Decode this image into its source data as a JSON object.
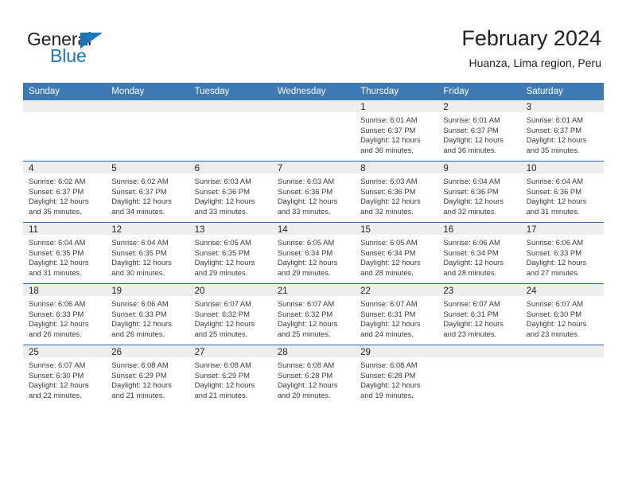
{
  "brand": {
    "name_part1": "General",
    "name_part2": "Blue",
    "accent_color": "#1b75bb",
    "text_color": "#231f20"
  },
  "header": {
    "title": "February 2024",
    "subtitle": "Huanza, Lima region, Peru"
  },
  "theme": {
    "header_blue": "#3c79b5",
    "row_divider": "#2f6da8",
    "daynum_band": "#eeeeee",
    "body_text": "#3a3a3a"
  },
  "weekdays": [
    "Sunday",
    "Monday",
    "Tuesday",
    "Wednesday",
    "Thursday",
    "Friday",
    "Saturday"
  ],
  "labels": {
    "sunrise_prefix": "Sunrise:",
    "sunset_prefix": "Sunset:",
    "daylight_prefix": "Daylight:"
  },
  "weeks": [
    [
      {
        "day": "",
        "blank": true,
        "l1": "",
        "l2": "",
        "l3": "",
        "l4": ""
      },
      {
        "day": "",
        "blank": true,
        "l1": "",
        "l2": "",
        "l3": "",
        "l4": ""
      },
      {
        "day": "",
        "blank": true,
        "l1": "",
        "l2": "",
        "l3": "",
        "l4": ""
      },
      {
        "day": "",
        "blank": true,
        "l1": "",
        "l2": "",
        "l3": "",
        "l4": ""
      },
      {
        "day": "1",
        "blank": false,
        "l1": "Sunrise: 6:01 AM",
        "l2": "Sunset: 6:37 PM",
        "l3": "Daylight: 12 hours",
        "l4": "and 36 minutes."
      },
      {
        "day": "2",
        "blank": false,
        "l1": "Sunrise: 6:01 AM",
        "l2": "Sunset: 6:37 PM",
        "l3": "Daylight: 12 hours",
        "l4": "and 36 minutes."
      },
      {
        "day": "3",
        "blank": false,
        "l1": "Sunrise: 6:01 AM",
        "l2": "Sunset: 6:37 PM",
        "l3": "Daylight: 12 hours",
        "l4": "and 35 minutes."
      }
    ],
    [
      {
        "day": "4",
        "blank": false,
        "l1": "Sunrise: 6:02 AM",
        "l2": "Sunset: 6:37 PM",
        "l3": "Daylight: 12 hours",
        "l4": "and 35 minutes."
      },
      {
        "day": "5",
        "blank": false,
        "l1": "Sunrise: 6:02 AM",
        "l2": "Sunset: 6:37 PM",
        "l3": "Daylight: 12 hours",
        "l4": "and 34 minutes."
      },
      {
        "day": "6",
        "blank": false,
        "l1": "Sunrise: 6:03 AM",
        "l2": "Sunset: 6:36 PM",
        "l3": "Daylight: 12 hours",
        "l4": "and 33 minutes."
      },
      {
        "day": "7",
        "blank": false,
        "l1": "Sunrise: 6:03 AM",
        "l2": "Sunset: 6:36 PM",
        "l3": "Daylight: 12 hours",
        "l4": "and 33 minutes."
      },
      {
        "day": "8",
        "blank": false,
        "l1": "Sunrise: 6:03 AM",
        "l2": "Sunset: 6:36 PM",
        "l3": "Daylight: 12 hours",
        "l4": "and 32 minutes."
      },
      {
        "day": "9",
        "blank": false,
        "l1": "Sunrise: 6:04 AM",
        "l2": "Sunset: 6:36 PM",
        "l3": "Daylight: 12 hours",
        "l4": "and 32 minutes."
      },
      {
        "day": "10",
        "blank": false,
        "l1": "Sunrise: 6:04 AM",
        "l2": "Sunset: 6:36 PM",
        "l3": "Daylight: 12 hours",
        "l4": "and 31 minutes."
      }
    ],
    [
      {
        "day": "11",
        "blank": false,
        "l1": "Sunrise: 6:04 AM",
        "l2": "Sunset: 6:35 PM",
        "l3": "Daylight: 12 hours",
        "l4": "and 31 minutes."
      },
      {
        "day": "12",
        "blank": false,
        "l1": "Sunrise: 6:04 AM",
        "l2": "Sunset: 6:35 PM",
        "l3": "Daylight: 12 hours",
        "l4": "and 30 minutes."
      },
      {
        "day": "13",
        "blank": false,
        "l1": "Sunrise: 6:05 AM",
        "l2": "Sunset: 6:35 PM",
        "l3": "Daylight: 12 hours",
        "l4": "and 29 minutes."
      },
      {
        "day": "14",
        "blank": false,
        "l1": "Sunrise: 6:05 AM",
        "l2": "Sunset: 6:34 PM",
        "l3": "Daylight: 12 hours",
        "l4": "and 29 minutes."
      },
      {
        "day": "15",
        "blank": false,
        "l1": "Sunrise: 6:05 AM",
        "l2": "Sunset: 6:34 PM",
        "l3": "Daylight: 12 hours",
        "l4": "and 28 minutes."
      },
      {
        "day": "16",
        "blank": false,
        "l1": "Sunrise: 6:06 AM",
        "l2": "Sunset: 6:34 PM",
        "l3": "Daylight: 12 hours",
        "l4": "and 28 minutes."
      },
      {
        "day": "17",
        "blank": false,
        "l1": "Sunrise: 6:06 AM",
        "l2": "Sunset: 6:33 PM",
        "l3": "Daylight: 12 hours",
        "l4": "and 27 minutes."
      }
    ],
    [
      {
        "day": "18",
        "blank": false,
        "l1": "Sunrise: 6:06 AM",
        "l2": "Sunset: 6:33 PM",
        "l3": "Daylight: 12 hours",
        "l4": "and 26 minutes."
      },
      {
        "day": "19",
        "blank": false,
        "l1": "Sunrise: 6:06 AM",
        "l2": "Sunset: 6:33 PM",
        "l3": "Daylight: 12 hours",
        "l4": "and 26 minutes."
      },
      {
        "day": "20",
        "blank": false,
        "l1": "Sunrise: 6:07 AM",
        "l2": "Sunset: 6:32 PM",
        "l3": "Daylight: 12 hours",
        "l4": "and 25 minutes."
      },
      {
        "day": "21",
        "blank": false,
        "l1": "Sunrise: 6:07 AM",
        "l2": "Sunset: 6:32 PM",
        "l3": "Daylight: 12 hours",
        "l4": "and 25 minutes."
      },
      {
        "day": "22",
        "blank": false,
        "l1": "Sunrise: 6:07 AM",
        "l2": "Sunset: 6:31 PM",
        "l3": "Daylight: 12 hours",
        "l4": "and 24 minutes."
      },
      {
        "day": "23",
        "blank": false,
        "l1": "Sunrise: 6:07 AM",
        "l2": "Sunset: 6:31 PM",
        "l3": "Daylight: 12 hours",
        "l4": "and 23 minutes."
      },
      {
        "day": "24",
        "blank": false,
        "l1": "Sunrise: 6:07 AM",
        "l2": "Sunset: 6:30 PM",
        "l3": "Daylight: 12 hours",
        "l4": "and 23 minutes."
      }
    ],
    [
      {
        "day": "25",
        "blank": false,
        "l1": "Sunrise: 6:07 AM",
        "l2": "Sunset: 6:30 PM",
        "l3": "Daylight: 12 hours",
        "l4": "and 22 minutes."
      },
      {
        "day": "26",
        "blank": false,
        "l1": "Sunrise: 6:08 AM",
        "l2": "Sunset: 6:29 PM",
        "l3": "Daylight: 12 hours",
        "l4": "and 21 minutes."
      },
      {
        "day": "27",
        "blank": false,
        "l1": "Sunrise: 6:08 AM",
        "l2": "Sunset: 6:29 PM",
        "l3": "Daylight: 12 hours",
        "l4": "and 21 minutes."
      },
      {
        "day": "28",
        "blank": false,
        "l1": "Sunrise: 6:08 AM",
        "l2": "Sunset: 6:28 PM",
        "l3": "Daylight: 12 hours",
        "l4": "and 20 minutes."
      },
      {
        "day": "29",
        "blank": false,
        "l1": "Sunrise: 6:08 AM",
        "l2": "Sunset: 6:28 PM",
        "l3": "Daylight: 12 hours",
        "l4": "and 19 minutes."
      },
      {
        "day": "",
        "blank": true,
        "l1": "",
        "l2": "",
        "l3": "",
        "l4": ""
      },
      {
        "day": "",
        "blank": true,
        "l1": "",
        "l2": "",
        "l3": "",
        "l4": ""
      }
    ]
  ]
}
